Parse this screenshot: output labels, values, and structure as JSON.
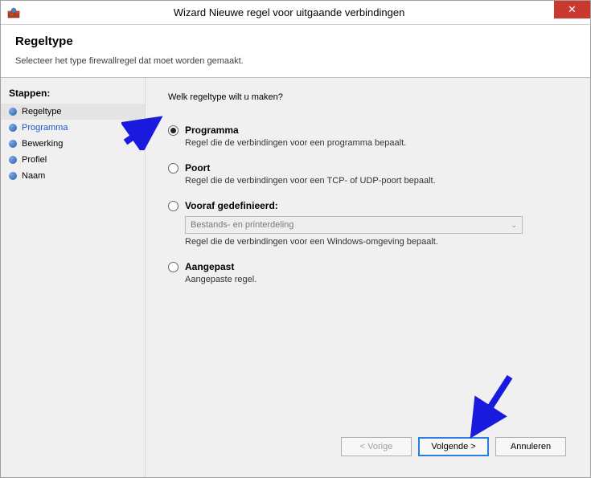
{
  "window": {
    "title": "Wizard Nieuwe regel voor uitgaande verbindingen"
  },
  "header": {
    "title": "Regeltype",
    "subtitle": "Selecteer het type firewallregel dat moet worden gemaakt."
  },
  "sidebar": {
    "title": "Stappen:",
    "steps": [
      {
        "label": "Regeltype"
      },
      {
        "label": "Programma"
      },
      {
        "label": "Bewerking"
      },
      {
        "label": "Profiel"
      },
      {
        "label": "Naam"
      }
    ]
  },
  "main": {
    "question": "Welk regeltype wilt u maken?",
    "options": [
      {
        "label": "Programma",
        "desc": "Regel die de verbindingen voor een programma bepaalt.",
        "checked": true
      },
      {
        "label": "Poort",
        "desc": "Regel die de verbindingen voor een TCP- of UDP-poort bepaalt.",
        "checked": false
      },
      {
        "label": "Vooraf gedefinieerd:",
        "desc": "Regel die de verbindingen voor een Windows-omgeving bepaalt.",
        "checked": false,
        "select_value": "Bestands- en printerdeling"
      },
      {
        "label": "Aangepast",
        "desc": "Aangepaste regel.",
        "checked": false
      }
    ]
  },
  "footer": {
    "back": "< Vorige",
    "next": "Volgende >",
    "cancel": "Annuleren"
  }
}
